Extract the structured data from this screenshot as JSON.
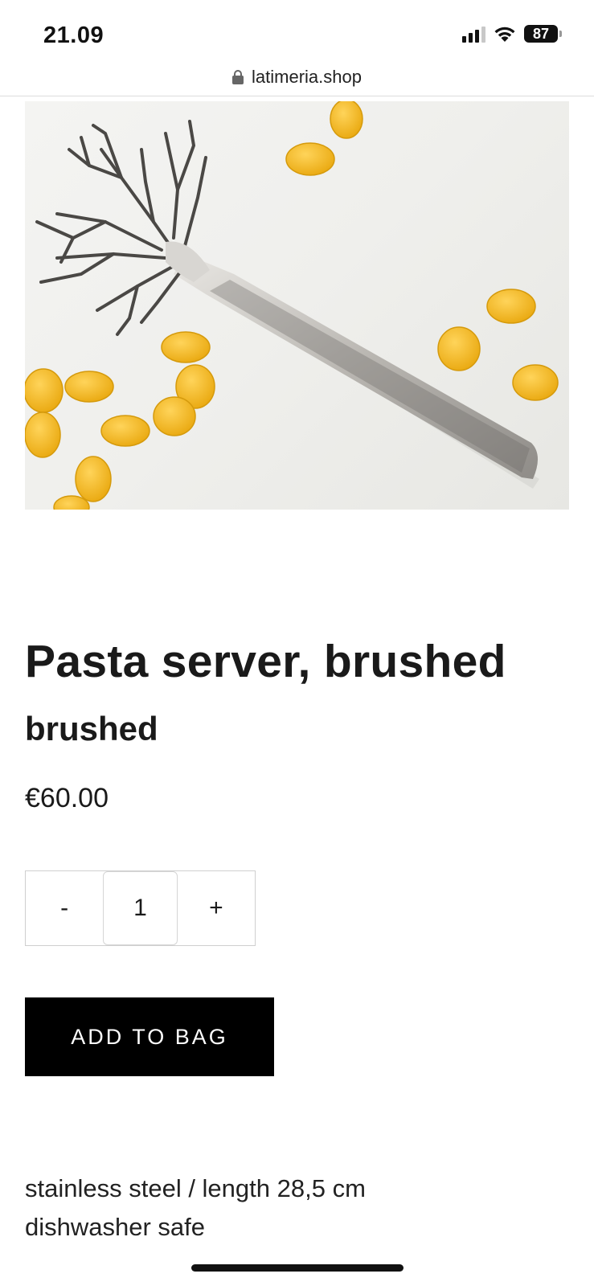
{
  "status_bar": {
    "time": "21.09",
    "battery_level": "87",
    "icons": [
      "signal-icon",
      "wifi-icon",
      "battery-icon"
    ]
  },
  "browser": {
    "url": "latimeria.shop",
    "secure_icon": "lock-icon"
  },
  "product": {
    "image_icon": "pasta-server-photo",
    "title": "Pasta server, brushed",
    "variant": "brushed",
    "price": "€60.00",
    "quantity": {
      "decrement_label": "-",
      "value": "1",
      "increment_label": "+"
    },
    "add_to_bag_label": "ADD TO BAG",
    "description_lines": [
      "stainless steel / length 28,5 cm",
      "dishwasher safe"
    ]
  },
  "colors": {
    "button_bg": "#000000",
    "button_text": "#ffffff",
    "text": "#1a1a1a",
    "pasta": "#f2b51c"
  }
}
